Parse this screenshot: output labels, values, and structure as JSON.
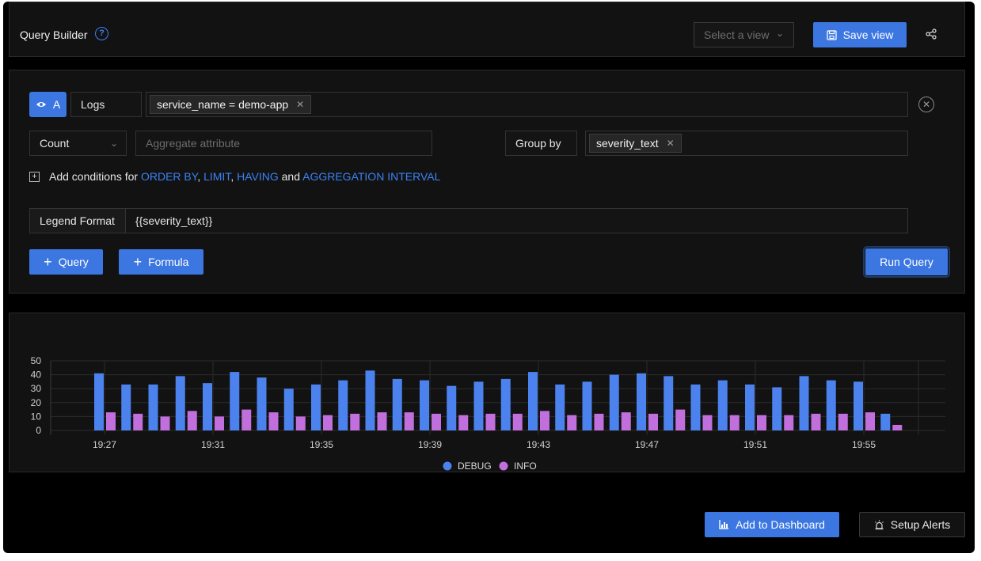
{
  "header": {
    "title": "Query Builder",
    "select_view_placeholder": "Select a view",
    "save_view_label": "Save view"
  },
  "query": {
    "name": "A",
    "data_source": "Logs",
    "filter_chip": "service_name = demo-app",
    "aggregate_operator": "Count",
    "aggregate_attribute_placeholder": "Aggregate attribute",
    "group_by_label": "Group by",
    "group_by_chip": "severity_text",
    "add_conditions": {
      "prefix": "Add conditions for",
      "order_by": "ORDER BY",
      "sep1": ",",
      "limit": "LIMIT",
      "sep2": ",",
      "having": "HAVING",
      "and": "and",
      "aggregation_interval": "AGGREGATION INTERVAL"
    },
    "legend_format_label": "Legend Format",
    "legend_format_value": "{{severity_text}}"
  },
  "actions": {
    "add_query": "Query",
    "add_formula": "Formula",
    "run_query": "Run Query",
    "add_to_dashboard": "Add to Dashboard",
    "setup_alerts": "Setup Alerts"
  },
  "colors": {
    "accent": "#3b76e1",
    "debug": "#4c82ee",
    "info": "#c06fdc"
  },
  "icons": [
    "help-icon",
    "chevron-down-icon",
    "save-icon",
    "share-icon",
    "eye-icon",
    "close-circle-icon",
    "plus-square-icon",
    "plus-icon",
    "chart-icon",
    "alarm-icon"
  ],
  "chart_data": {
    "type": "bar",
    "categories": [
      "19:27",
      "19:28",
      "19:29",
      "19:30",
      "19:31",
      "19:32",
      "19:33",
      "19:34",
      "19:35",
      "19:36",
      "19:37",
      "19:38",
      "19:39",
      "19:40",
      "19:41",
      "19:42",
      "19:43",
      "19:44",
      "19:45",
      "19:46",
      "19:47",
      "19:48",
      "19:49",
      "19:50",
      "19:51",
      "19:52",
      "19:53",
      "19:54",
      "19:55",
      "19:56"
    ],
    "x_tick_labels": [
      "19:27",
      "19:31",
      "19:35",
      "19:39",
      "19:43",
      "19:47",
      "19:51",
      "19:55"
    ],
    "y_ticks": [
      0,
      10,
      20,
      30,
      40,
      50
    ],
    "ylim": [
      0,
      50
    ],
    "grid": true,
    "legend_position": "bottom-center",
    "series": [
      {
        "name": "DEBUG",
        "values": [
          41,
          33,
          33,
          39,
          34,
          42,
          38,
          30,
          33,
          36,
          43,
          37,
          36,
          32,
          35,
          37,
          42,
          33,
          35,
          40,
          41,
          39,
          33,
          36,
          33,
          31,
          39,
          36,
          35,
          12
        ]
      },
      {
        "name": "INFO",
        "values": [
          13,
          12,
          10,
          14,
          10,
          15,
          13,
          10,
          11,
          12,
          13,
          13,
          12,
          11,
          12,
          12,
          14,
          11,
          12,
          13,
          12,
          15,
          11,
          11,
          11,
          11,
          12,
          12,
          13,
          4
        ]
      }
    ]
  }
}
